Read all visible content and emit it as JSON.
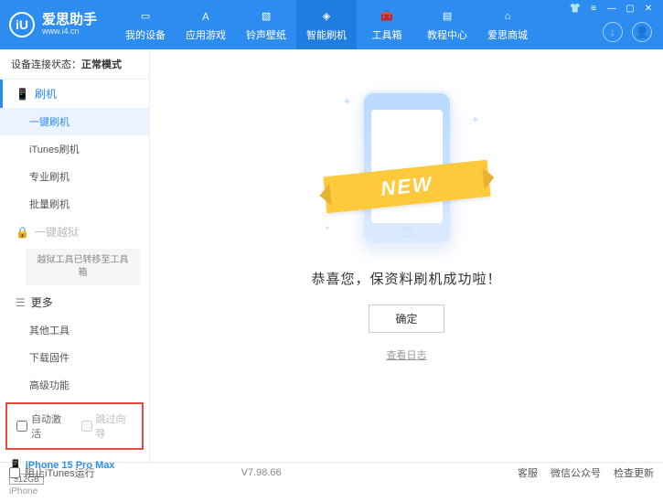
{
  "header": {
    "logo_letter": "iU",
    "app_name": "爱思助手",
    "site": "www.i4.cn"
  },
  "nav": {
    "items": [
      {
        "label": "我的设备"
      },
      {
        "label": "应用游戏"
      },
      {
        "label": "铃声壁纸"
      },
      {
        "label": "智能刷机"
      },
      {
        "label": "工具箱"
      },
      {
        "label": "教程中心"
      },
      {
        "label": "爱思商城"
      }
    ],
    "active_index": 3
  },
  "status": {
    "prefix": "设备连接状态：",
    "value": "正常模式"
  },
  "sidebar": {
    "flash": {
      "header": "刷机",
      "items": [
        "一键刷机",
        "iTunes刷机",
        "专业刷机",
        "批量刷机"
      ],
      "active_index": 0
    },
    "jailbreak": {
      "header": "一键越狱",
      "notice": "越狱工具已转移至工具箱"
    },
    "more": {
      "header": "更多",
      "items": [
        "其他工具",
        "下载固件",
        "高级功能"
      ]
    }
  },
  "checkboxes": {
    "auto_activate": "自动激活",
    "skip_setup": "跳过向导"
  },
  "device": {
    "name": "iPhone 15 Pro Max",
    "storage": "512GB",
    "type": "iPhone"
  },
  "main": {
    "ribbon": "NEW",
    "message": "恭喜您，保资料刷机成功啦！",
    "ok": "确定",
    "log_link": "查看日志"
  },
  "footer": {
    "block_itunes": "阻止iTunes运行",
    "version": "V7.98.66",
    "links": [
      "客服",
      "微信公众号",
      "检查更新"
    ]
  }
}
